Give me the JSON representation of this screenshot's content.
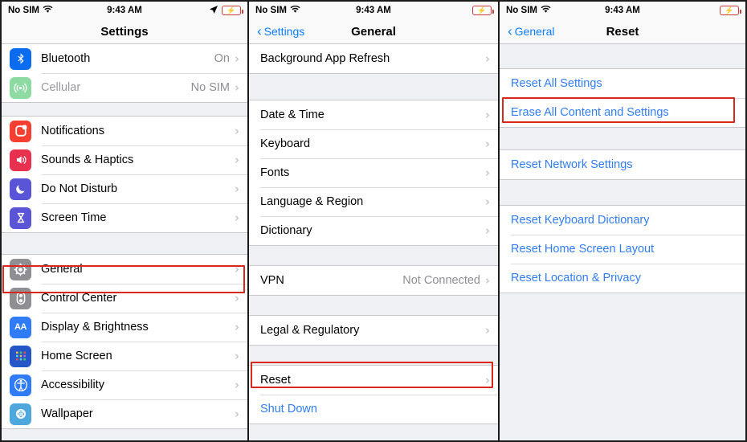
{
  "highlight_color": "#d8281c",
  "accent_blue": "#307df6",
  "panels": [
    {
      "id": "settings",
      "status": {
        "carrier": "No SIM",
        "time": "9:43 AM",
        "wifi_icon": "wifi-icon",
        "location_icon": "location-arrow-icon",
        "battery_icon": "battery-charging-icon"
      },
      "nav": {
        "back_label": "",
        "title": "Settings"
      },
      "groups": [
        {
          "rows": [
            {
              "label": "Bluetooth",
              "value": "On",
              "icon": "bluetooth-icon",
              "icon_color": "#0b6cf0",
              "chevron": true
            },
            {
              "label": "Cellular",
              "value": "No SIM",
              "icon": "cellular-icon",
              "icon_color": "#8ddba2",
              "chevron": true,
              "dim": true
            }
          ]
        },
        {
          "rows": [
            {
              "label": "Notifications",
              "value": "",
              "icon": "notifications-icon",
              "icon_color": "#f53f30",
              "chevron": true
            },
            {
              "label": "Sounds & Haptics",
              "value": "",
              "icon": "sounds-haptics-icon",
              "icon_color": "#e8304f",
              "chevron": true
            },
            {
              "label": "Do Not Disturb",
              "value": "",
              "icon": "do-not-disturb-icon",
              "icon_color": "#5a54d6",
              "chevron": true
            },
            {
              "label": "Screen Time",
              "value": "",
              "icon": "screen-time-icon",
              "icon_color": "#5a54d6",
              "chevron": true
            }
          ]
        },
        {
          "rows": [
            {
              "label": "General",
              "value": "",
              "icon": "gear-icon",
              "icon_color": "#8e8e93",
              "chevron": true,
              "highlighted": true
            },
            {
              "label": "Control Center",
              "value": "",
              "icon": "control-center-icon",
              "icon_color": "#8e8e93",
              "chevron": true
            },
            {
              "label": "Display & Brightness",
              "value": "",
              "icon": "display-brightness-icon",
              "icon_color": "#2f7cf6",
              "chevron": true
            },
            {
              "label": "Home Screen",
              "value": "",
              "icon": "home-screen-icon",
              "icon_color": "#2556c8",
              "chevron": true
            },
            {
              "label": "Accessibility",
              "value": "",
              "icon": "accessibility-icon",
              "icon_color": "#2f7cf6",
              "chevron": true
            },
            {
              "label": "Wallpaper",
              "value": "",
              "icon": "wallpaper-icon",
              "icon_color": "#4ea8dd",
              "chevron": true
            }
          ]
        }
      ]
    },
    {
      "id": "general",
      "status": {
        "carrier": "No SIM",
        "time": "9:43 AM",
        "wifi_icon": "wifi-icon",
        "battery_icon": "battery-charging-icon"
      },
      "nav": {
        "back_label": "Settings",
        "title": "General"
      },
      "groups": [
        {
          "rows": [
            {
              "label": "Background App Refresh",
              "value": "",
              "chevron": true
            }
          ]
        },
        {
          "rows": [
            {
              "label": "Date & Time",
              "value": "",
              "chevron": true
            },
            {
              "label": "Keyboard",
              "value": "",
              "chevron": true
            },
            {
              "label": "Fonts",
              "value": "",
              "chevron": true
            },
            {
              "label": "Language & Region",
              "value": "",
              "chevron": true
            },
            {
              "label": "Dictionary",
              "value": "",
              "chevron": true
            }
          ]
        },
        {
          "rows": [
            {
              "label": "VPN",
              "value": "Not Connected",
              "chevron": true
            }
          ]
        },
        {
          "rows": [
            {
              "label": "Legal & Regulatory",
              "value": "",
              "chevron": true
            }
          ]
        },
        {
          "rows": [
            {
              "label": "Reset",
              "value": "",
              "chevron": true,
              "highlighted": true
            },
            {
              "label": "Shut Down",
              "value": "",
              "chevron": false,
              "blue": true
            }
          ]
        }
      ]
    },
    {
      "id": "reset",
      "status": {
        "carrier": "No SIM",
        "time": "9:43 AM",
        "wifi_icon": "wifi-icon",
        "battery_icon": "battery-charging-icon"
      },
      "nav": {
        "back_label": "General",
        "title": "Reset"
      },
      "groups": [
        {
          "rows": [
            {
              "label": "Reset All Settings",
              "value": "",
              "chevron": false,
              "blue": true
            },
            {
              "label": "Erase All Content and Settings",
              "value": "",
              "chevron": false,
              "blue": true,
              "highlighted": true
            }
          ]
        },
        {
          "rows": [
            {
              "label": "Reset Network Settings",
              "value": "",
              "chevron": false,
              "blue": true
            }
          ]
        },
        {
          "rows": [
            {
              "label": "Reset Keyboard Dictionary",
              "value": "",
              "chevron": false,
              "blue": true
            },
            {
              "label": "Reset Home Screen Layout",
              "value": "",
              "chevron": false,
              "blue": true
            },
            {
              "label": "Reset Location & Privacy",
              "value": "",
              "chevron": false,
              "blue": true
            }
          ]
        }
      ]
    }
  ]
}
